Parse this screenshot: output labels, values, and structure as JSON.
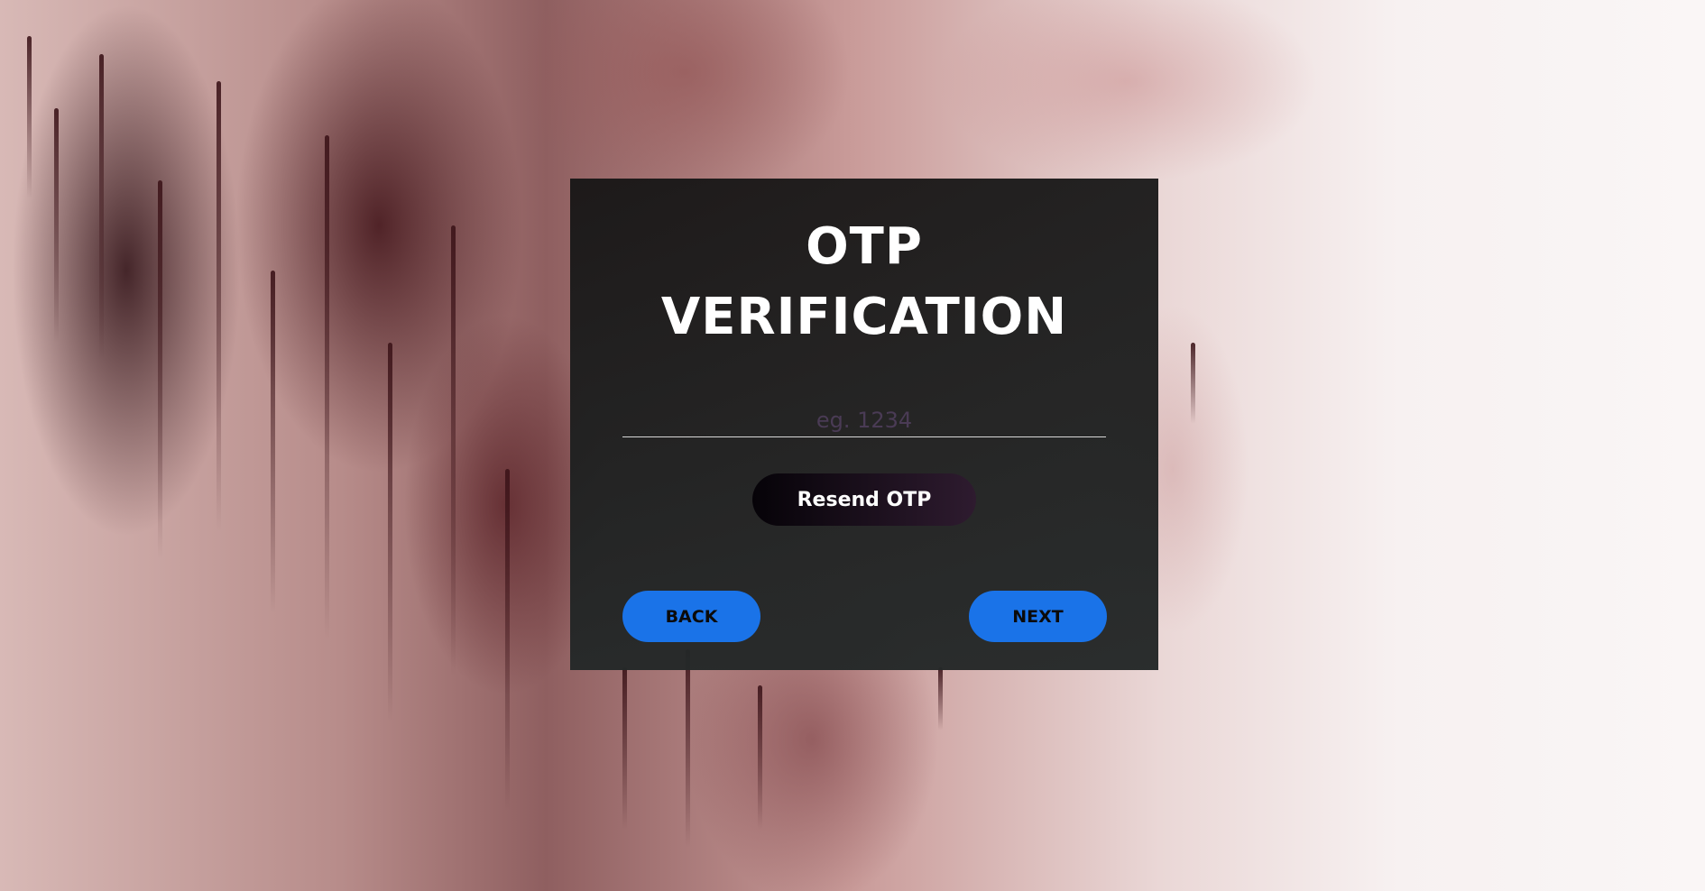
{
  "otp_card": {
    "title_line1": "OTP",
    "title_line2": "VERIFICATION",
    "otp_placeholder": "eg. 1234",
    "otp_value": "",
    "resend_label": "Resend OTP",
    "back_label": "BACK",
    "next_label": "NEXT"
  },
  "colors": {
    "accent": "#1a73e8",
    "card_bg": "#1b1d1d",
    "title_text": "#ffffff",
    "resend_gradient_start": "#060308",
    "resend_gradient_end": "#2e1b2f"
  }
}
